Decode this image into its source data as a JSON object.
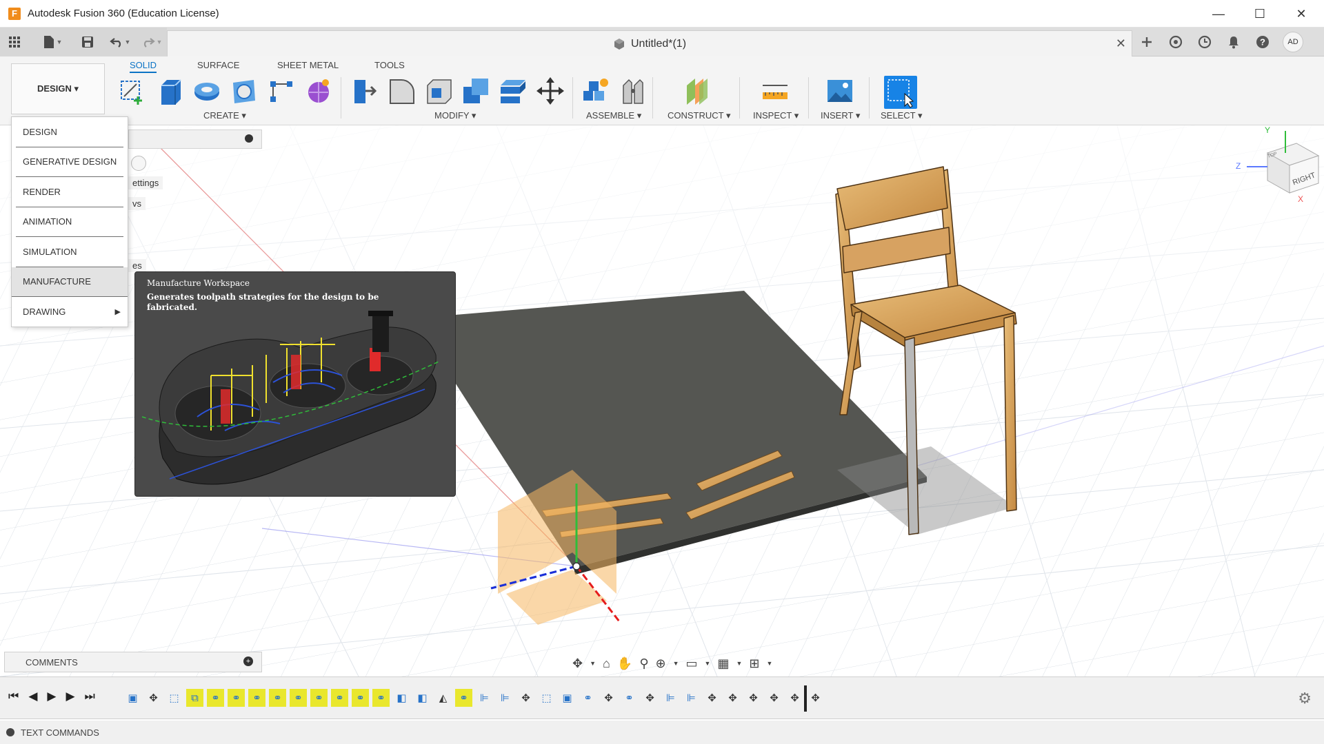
{
  "window": {
    "app_icon_letter": "F",
    "title": "Autodesk Fusion 360 (Education License)",
    "minimize": "—",
    "maximize": "☐",
    "close": "✕"
  },
  "quick_access": {
    "document_title": "Untitled*(1)",
    "close": "✕",
    "user_initials": "AD"
  },
  "ribbon": {
    "workspace": "DESIGN ▾",
    "tabs": [
      {
        "label": "SOLID",
        "active": true
      },
      {
        "label": "SURFACE",
        "active": false
      },
      {
        "label": "SHEET METAL",
        "active": false
      },
      {
        "label": "TOOLS",
        "active": false
      }
    ],
    "groups": {
      "create": "CREATE ▾",
      "modify": "MODIFY ▾",
      "assemble": "ASSEMBLE ▾",
      "construct": "CONSTRUCT ▾",
      "inspect": "INSPECT ▾",
      "insert": "INSERT ▾",
      "select": "SELECT ▾"
    }
  },
  "workspace_menu": {
    "items": [
      {
        "label": "DESIGN"
      },
      {
        "label": "GENERATIVE DESIGN"
      },
      {
        "label": "RENDER"
      },
      {
        "label": "ANIMATION"
      },
      {
        "label": "SIMULATION"
      },
      {
        "label": "MANUFACTURE",
        "hovered": true
      },
      {
        "label": "DRAWING",
        "submenu": true
      }
    ]
  },
  "tooltip": {
    "title": "Manufacture Workspace",
    "description": "Generates toolpath strategies for the design to be fabricated."
  },
  "browser": {
    "fragments": [
      "ettings",
      "vs",
      "es"
    ]
  },
  "viewcube": {
    "face_label": "RIGHT",
    "top_label": "TOP",
    "axis_x": "X",
    "axis_y": "Y",
    "axis_z": "Z"
  },
  "comments": {
    "label": "COMMENTS"
  },
  "text_commands": {
    "label": "TEXT COMMANDS"
  },
  "colors": {
    "accent": "#0b73c5",
    "timeline_highlight": "#e9e72d",
    "tooltip_bg": "#4a4a4a",
    "wood": "#d9a25a",
    "board": "#555652"
  }
}
